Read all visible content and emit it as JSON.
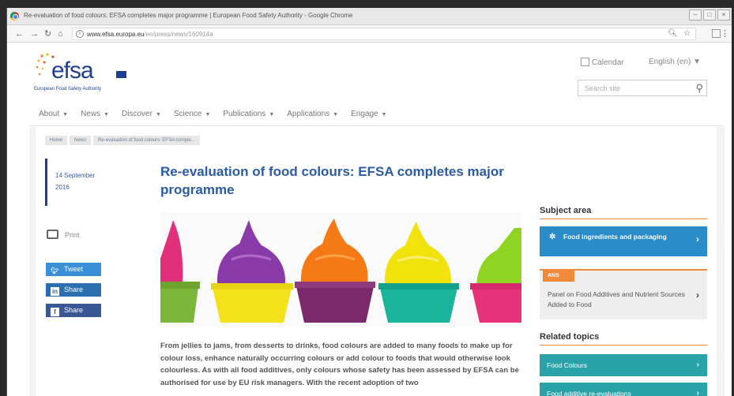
{
  "browser": {
    "window_title": "Re-evaluation of food colours: EFSA completes major programme | European Food Safety Authority - Google Chrome",
    "url_host": "www.efsa.europa.eu",
    "url_path": "/en/press/news/160914a",
    "zoom_icon": "zoom-icon",
    "window_buttons": [
      "–",
      "□",
      "×"
    ]
  },
  "header": {
    "logo_text": "efsa",
    "logo_subtitle": "European Food Safety Authority",
    "calendar_label": "Calendar",
    "language_label": "English (en)",
    "search_placeholder": "Search site"
  },
  "nav": {
    "items": [
      "About",
      "News",
      "Discover",
      "Science",
      "Publications",
      "Applications",
      "Engage"
    ]
  },
  "breadcrumb": [
    "Home",
    "News",
    "Re-evaluation of food colours: EFSA comple..."
  ],
  "article": {
    "date_line1": "14 September",
    "date_line2": "2016",
    "title": "Re-evaluation of food colours: EFSA completes major programme",
    "body": "From jellies to jams, from desserts to drinks, food colours are added to many foods to make up for colour loss, enhance naturally occurring colours or add colour to foods that would otherwise look colourless. As with all food additives, only colours whose safety has been assessed by EFSA can be authorised for use by EU risk managers. With the recent adoption of two"
  },
  "tools": {
    "print_label": "Print",
    "tweet_label": "Tweet",
    "linkedin_label": "Share",
    "facebook_label": "Share"
  },
  "sidebar": {
    "subject_heading": "Subject area",
    "subject_link": "Food ingredients and packaging",
    "panel_tag": "ANS",
    "panel_text": "Panel on Food Additives and Nutrient Sources Added to Food",
    "related_heading": "Related topics",
    "related": [
      "Food Colours",
      "Food additive re-evaluations"
    ]
  },
  "colors": {
    "brand_blue": "#1c3f95",
    "link_blue": "#2a5ba6",
    "accent_orange": "#f08a3a",
    "teal": "#2aa3a8"
  }
}
